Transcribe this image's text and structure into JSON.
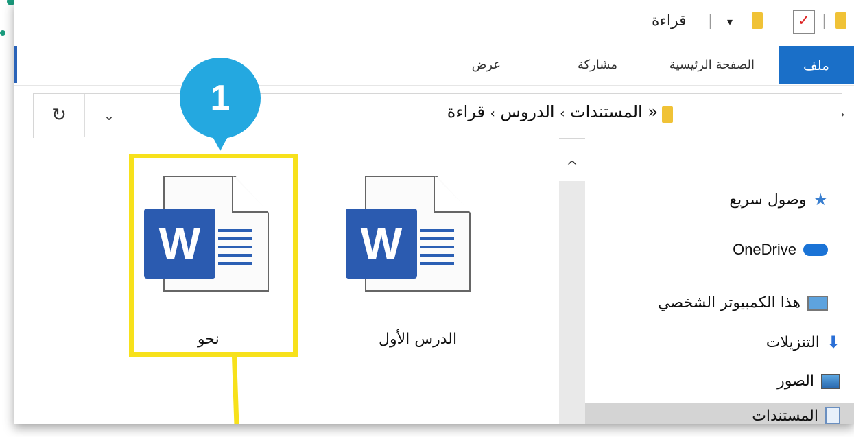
{
  "window": {
    "title": "قراءة",
    "title_separator": "|",
    "qat_dropdown": "▾",
    "qat_separator": "|"
  },
  "ribbon": {
    "tabs": [
      {
        "label": "ملف",
        "active": true
      },
      {
        "label": "الصفحة الرئيسية"
      },
      {
        "label": "مشاركة"
      },
      {
        "label": "عرض"
      }
    ]
  },
  "address_bar": {
    "path": [
      "المستندات",
      "الدروس",
      "قراءة"
    ],
    "overflow_marker": "«",
    "separator": "›",
    "back_icon": "→",
    "forward_icon": "←",
    "recent_icon": "⌄",
    "up_icon": "↑",
    "dropdown_icon": "⌄",
    "refresh_icon": "↻"
  },
  "sidebar": {
    "items": [
      {
        "label": "وصول سريع",
        "icon": "star-icon"
      },
      {
        "label": "OneDrive",
        "icon": "cloud-icon"
      },
      {
        "label": "هذا الكمبيوتر الشخصي",
        "icon": "computer-icon"
      },
      {
        "label": "التنزيلات",
        "icon": "download-arrow-icon"
      },
      {
        "label": "الصور",
        "icon": "pictures-icon"
      },
      {
        "label": "المستندات",
        "icon": "documents-icon",
        "selected": true
      }
    ]
  },
  "files": [
    {
      "name": "الدرس الأول",
      "type": "word",
      "badge": "W"
    },
    {
      "name": "نحو",
      "type": "word",
      "badge": "W",
      "highlighted": true
    }
  ],
  "callout": {
    "number": "1"
  },
  "scrollbar": {
    "up_arrow": "^"
  },
  "colors": {
    "accent": "#1a6fc8",
    "highlight": "#f7e11b",
    "callout": "#24a8e0",
    "word": "#2b5bb0",
    "brand_dots": "#1a9b7d"
  }
}
